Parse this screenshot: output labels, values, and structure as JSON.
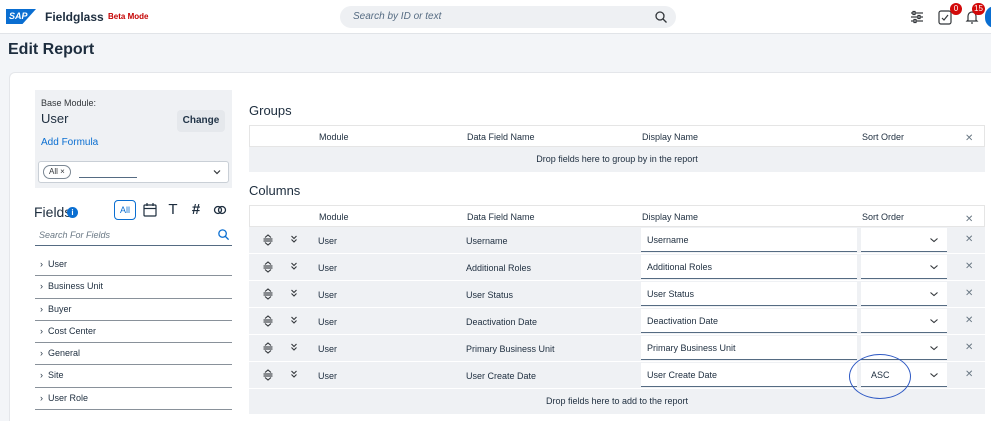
{
  "header": {
    "logo_text": "SAP",
    "brand": "Fieldglass",
    "mode": "Beta Mode",
    "search_placeholder": "Search by ID or text",
    "tasks_badge": "0",
    "notifications_badge": "15"
  },
  "page_title": "Edit Report",
  "left_panel": {
    "base_module_label": "Base Module:",
    "base_module_value": "User",
    "change_label": "Change",
    "add_formula_label": "Add Formula",
    "filter_token": "All ×",
    "fields_title": "Fields",
    "field_type_filters": [
      "All",
      "calendar-icon",
      "T",
      "#",
      "link-icon"
    ],
    "field_search_placeholder": "Search For Fields",
    "field_groups": [
      "User",
      "Business Unit",
      "Buyer",
      "Cost Center",
      "General",
      "Site",
      "User Role"
    ]
  },
  "groups": {
    "title": "Groups",
    "headers": [
      "Module",
      "Data Field Name",
      "Display Name",
      "Sort Order"
    ],
    "drop_text": "Drop fields here to group by in the report"
  },
  "columns": {
    "title": "Columns",
    "headers": [
      "Module",
      "Data Field Name",
      "Display Name",
      "Sort Order"
    ],
    "rows": [
      {
        "module": "User",
        "field": "Username",
        "display": "Username",
        "sort": ""
      },
      {
        "module": "User",
        "field": "Additional Roles",
        "display": "Additional Roles",
        "sort": ""
      },
      {
        "module": "User",
        "field": "User Status",
        "display": "User Status",
        "sort": ""
      },
      {
        "module": "User",
        "field": "Deactivation Date",
        "display": "Deactivation Date",
        "sort": ""
      },
      {
        "module": "User",
        "field": "Primary Business Unit",
        "display": "Primary Business Unit",
        "sort": ""
      },
      {
        "module": "User",
        "field": "User Create Date",
        "display": "User Create Date",
        "sort": "ASC"
      }
    ],
    "drop_text": "Drop fields here to add to the report"
  },
  "colors": {
    "accent": "#0a6ed1",
    "badge": "#d20a0a",
    "annotation_circle": "#2e59c4"
  }
}
